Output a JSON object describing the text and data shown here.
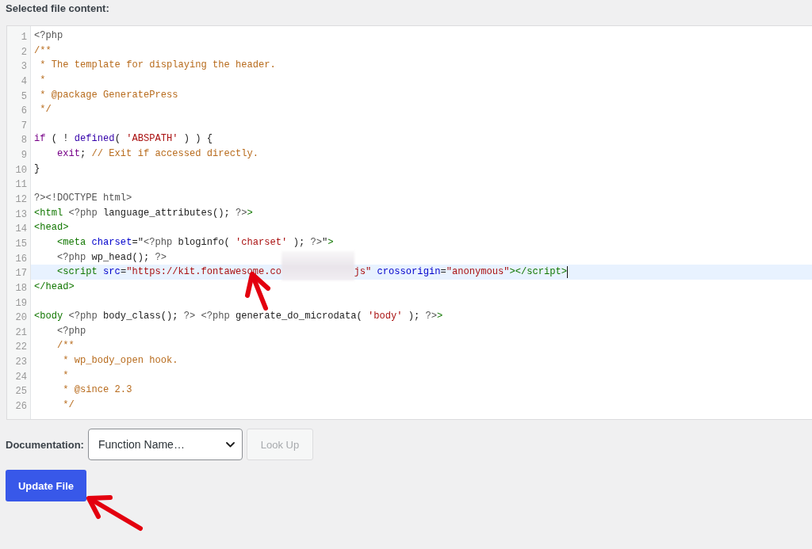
{
  "section_title": "Selected file content:",
  "editor": {
    "lines": [
      {
        "number": "1",
        "active": false,
        "tokens": [
          {
            "kind": "meta",
            "text": "<?php"
          }
        ]
      },
      {
        "number": "2",
        "active": false,
        "tokens": [
          {
            "kind": "comment",
            "text": "/**"
          }
        ]
      },
      {
        "number": "3",
        "active": false,
        "tokens": [
          {
            "kind": "comment",
            "text": " * The template for displaying the header."
          }
        ]
      },
      {
        "number": "4",
        "active": false,
        "tokens": [
          {
            "kind": "comment",
            "text": " *"
          }
        ]
      },
      {
        "number": "5",
        "active": false,
        "tokens": [
          {
            "kind": "comment",
            "text": " * @package GeneratePress"
          }
        ]
      },
      {
        "number": "6",
        "active": false,
        "tokens": [
          {
            "kind": "comment",
            "text": " */"
          }
        ]
      },
      {
        "number": "7",
        "active": false
      },
      {
        "number": "8",
        "active": false,
        "tokens": [
          {
            "kind": "keyword",
            "text": "if"
          },
          {
            "kind": "plain",
            "text": " ( ! "
          },
          {
            "kind": "builtin",
            "text": "defined"
          },
          {
            "kind": "plain",
            "text": "( "
          },
          {
            "kind": "string",
            "text": "'ABSPATH'"
          },
          {
            "kind": "plain",
            "text": " ) ) {"
          }
        ]
      },
      {
        "number": "9",
        "active": false,
        "tokens": [
          {
            "kind": "keyword",
            "text": "    exit"
          },
          {
            "kind": "plain",
            "text": "; "
          },
          {
            "kind": "comment",
            "text": "// Exit if accessed directly."
          }
        ]
      },
      {
        "number": "10",
        "active": false,
        "tokens": [
          {
            "kind": "plain",
            "text": "}"
          }
        ]
      },
      {
        "number": "11",
        "active": false
      },
      {
        "number": "12",
        "active": false,
        "tokens": [
          {
            "kind": "meta",
            "text": "?><!DOCTYPE html>"
          }
        ]
      },
      {
        "number": "13",
        "active": false,
        "tokens": [
          {
            "kind": "tag",
            "text": "<html"
          },
          {
            "kind": "meta",
            "text": " <?php"
          },
          {
            "kind": "plain",
            "text": " language_attributes(); "
          },
          {
            "kind": "meta",
            "text": "?>"
          },
          {
            "kind": "tag",
            "text": ">"
          }
        ]
      },
      {
        "number": "14",
        "active": false,
        "tokens": [
          {
            "kind": "tag",
            "text": "<head>"
          }
        ]
      },
      {
        "number": "15",
        "active": false,
        "tokens": [
          {
            "kind": "tag",
            "text": "    <meta"
          },
          {
            "kind": "attribute",
            "text": " charset"
          },
          {
            "kind": "plain",
            "text": "=\""
          },
          {
            "kind": "meta",
            "text": "<?php"
          },
          {
            "kind": "plain",
            "text": " bloginfo( "
          },
          {
            "kind": "string",
            "text": "'charset'"
          },
          {
            "kind": "plain",
            "text": " ); "
          },
          {
            "kind": "meta",
            "text": "?>"
          },
          {
            "kind": "plain",
            "text": "\""
          },
          {
            "kind": "tag",
            "text": ">"
          }
        ]
      },
      {
        "number": "16",
        "active": false,
        "tokens": [
          {
            "kind": "meta",
            "text": "    <?php"
          },
          {
            "kind": "plain",
            "text": " wp_head(); "
          },
          {
            "kind": "meta",
            "text": "?>"
          }
        ]
      },
      {
        "number": "17",
        "active": true,
        "tokens": [
          {
            "kind": "tag",
            "text": "    <script"
          },
          {
            "kind": "attribute",
            "text": " src"
          },
          {
            "kind": "plain",
            "text": "="
          },
          {
            "kind": "string",
            "text": "\"https://kit.fontawesome.co"
          },
          {
            "kind": "redacted"
          },
          {
            "kind": "string",
            "text": "js\""
          },
          {
            "kind": "attribute",
            "text": " crossorigin"
          },
          {
            "kind": "plain",
            "text": "="
          },
          {
            "kind": "string",
            "text": "\"anonymous\""
          },
          {
            "kind": "tag",
            "text": "></script>"
          }
        ]
      },
      {
        "number": "18",
        "active": false,
        "tokens": [
          {
            "kind": "tag",
            "text": "</head>"
          }
        ]
      },
      {
        "number": "19",
        "active": false
      },
      {
        "number": "20",
        "active": false,
        "tokens": [
          {
            "kind": "tag",
            "text": "<body"
          },
          {
            "kind": "meta",
            "text": " <?php"
          },
          {
            "kind": "plain",
            "text": " body_class(); "
          },
          {
            "kind": "meta",
            "text": "?>"
          },
          {
            "kind": "meta",
            "text": " <?php"
          },
          {
            "kind": "plain",
            "text": " generate_do_microdata( "
          },
          {
            "kind": "string",
            "text": "'body'"
          },
          {
            "kind": "plain",
            "text": " ); "
          },
          {
            "kind": "meta",
            "text": "?>"
          },
          {
            "kind": "tag",
            "text": ">"
          }
        ]
      },
      {
        "number": "21",
        "active": false,
        "tokens": [
          {
            "kind": "meta",
            "text": "    <?php"
          }
        ]
      },
      {
        "number": "22",
        "active": false,
        "tokens": [
          {
            "kind": "comment",
            "text": "    /**"
          }
        ]
      },
      {
        "number": "23",
        "active": false,
        "tokens": [
          {
            "kind": "comment",
            "text": "     * wp_body_open hook."
          }
        ]
      },
      {
        "number": "24",
        "active": false,
        "tokens": [
          {
            "kind": "comment",
            "text": "     *"
          }
        ]
      },
      {
        "number": "25",
        "active": false,
        "tokens": [
          {
            "kind": "comment",
            "text": "     * @since 2.3"
          }
        ]
      },
      {
        "number": "26",
        "active": false,
        "tokens": [
          {
            "kind": "comment",
            "text": "     */"
          }
        ]
      }
    ]
  },
  "documentation": {
    "label": "Documentation:",
    "select": {
      "value": "Function Name…"
    },
    "lookup_button": {
      "label": "Look Up",
      "disabled": true
    }
  },
  "update_button": {
    "label": "Update File"
  }
}
